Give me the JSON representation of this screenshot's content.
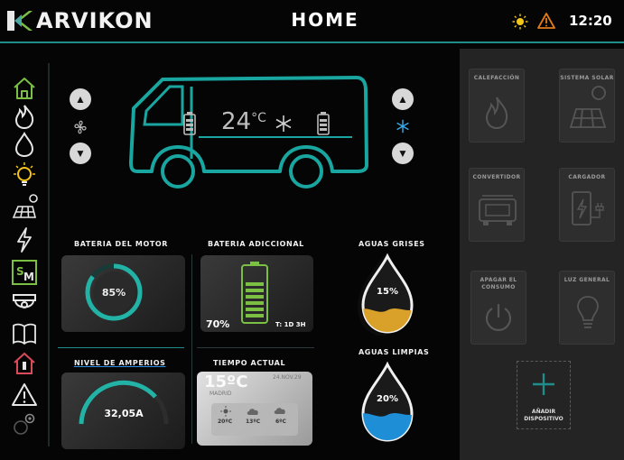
{
  "header": {
    "brand": "ARVIKON",
    "title": "HOME",
    "time": "12:20"
  },
  "van": {
    "temperature": "24",
    "temp_unit": "°C"
  },
  "widgets": {
    "motor_battery": {
      "label": "BATERIA DEL MOTOR",
      "percent": "85%"
    },
    "extra_battery": {
      "label": "BATERIA ADICCIONAL",
      "percent": "70%",
      "time": "T: 1D 3H"
    },
    "grey_water": {
      "label": "AGUAS GRISES",
      "percent": "15%"
    },
    "amps": {
      "label": "NIVEL DE AMPERIOS",
      "value": "32,05A"
    },
    "weather": {
      "label": "TIEMPO ACTUAL",
      "temp": "15ºC",
      "date": "24.NOV.29",
      "city": "MADRID",
      "forecast": [
        {
          "temp": "20ºC"
        },
        {
          "temp": "13ºC"
        },
        {
          "temp": "6ºC"
        }
      ]
    },
    "clean_water": {
      "label": "AGUAS LIMPIAS",
      "percent": "20%"
    }
  },
  "devices": [
    {
      "label": "CALEFACCIÓN",
      "icon": "flame-icon"
    },
    {
      "label": "SISTEMA SOLAR",
      "icon": "solar-panel-icon"
    },
    {
      "label": "CONVERTIDOR",
      "icon": "converter-icon"
    },
    {
      "label": "CARGADOR",
      "icon": "charger-icon"
    },
    {
      "label": "APAGAR EL CONSUMO",
      "icon": "power-icon"
    },
    {
      "label": "LUZ GENERAL",
      "icon": "bulb-icon"
    }
  ],
  "add_device": {
    "label": "AÑADIR DISPOSITIVO"
  },
  "colors": {
    "accent": "#1f8d8a",
    "teal": "#23b3a6",
    "grey_water": "#d9a12a",
    "clean_water": "#1e8fd6",
    "warning": "#e07a1a",
    "sun": "#f5c518"
  }
}
